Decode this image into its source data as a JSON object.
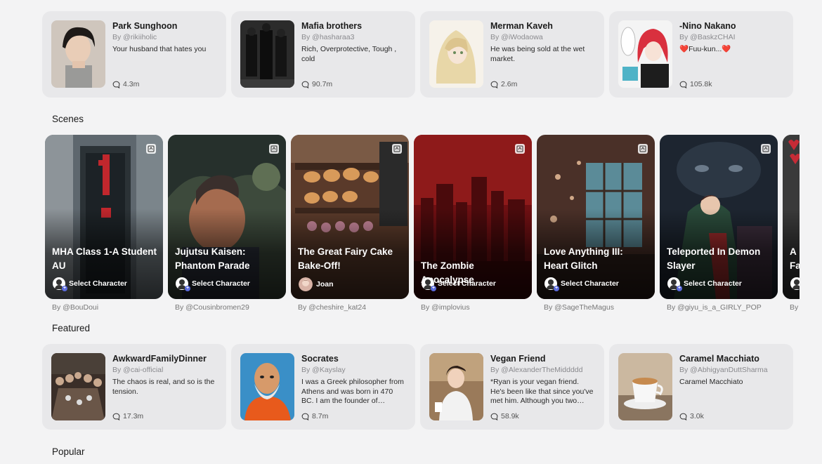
{
  "top_characters": [
    {
      "name": "Park Sunghoon",
      "by": "By @rikiiholic",
      "desc": "Your husband that hates you",
      "count": "4.3m",
      "avatar_icon": "portrait-dark-hair-icon"
    },
    {
      "name": "Mafia brothers",
      "by": "By @hasharaa3",
      "desc": "Rich, Overprotective, Tough , cold",
      "count": "90.7m",
      "avatar_icon": "men-in-suits-icon"
    },
    {
      "name": "Merman Kaveh",
      "by": "By @iWodaowa",
      "desc": "He was being sold at the wet market.",
      "count": "2.6m",
      "avatar_icon": "blond-anime-icon"
    },
    {
      "name": "-Nino Nakano",
      "by": "By @BaskzCHAI",
      "desc": "❤️Fuu-kun...❤️",
      "count": "105.8k",
      "avatar_icon": "red-hair-anime-icon"
    }
  ],
  "sections": {
    "scenes": "Scenes",
    "featured": "Featured",
    "popular": "Popular"
  },
  "scenes": [
    {
      "title": "MHA Class 1-A Student AU",
      "action": "Select Character",
      "by": "By @BouDoui"
    },
    {
      "title": "Jujutsu Kaisen: Phantom Parade",
      "action": "Select Character",
      "by": "By @Cousinbromen29"
    },
    {
      "title": "The Great Fairy Cake Bake-Off!",
      "action": "Joan",
      "by": "By @cheshire_kat24"
    },
    {
      "title": "The Zombie Apocalypse",
      "action": "Select Character",
      "by": "By @implovius"
    },
    {
      "title": "Love Anything III: Heart Glitch",
      "action": "Select Character",
      "by": "By @SageTheMagus"
    },
    {
      "title": "Teleported In Demon Slayer",
      "action": "Select Character",
      "by": "By @giyu_is_a_GIRLY_POP"
    },
    {
      "title": "A Fa",
      "action": "",
      "by": "By"
    }
  ],
  "featured_characters": [
    {
      "name": "AwkwardFamilyDinner",
      "by": "By @cai-official",
      "desc": "The chaos is real, and so is the tension.",
      "count": "17.3m",
      "avatar_icon": "dinner-table-icon"
    },
    {
      "name": "Socrates",
      "by": "By @Kayslay",
      "desc": "I was a Greek philosopher from Athens and was born in 470 BC. I am the founder of western...",
      "count": "8.7m",
      "avatar_icon": "bearded-philosopher-icon"
    },
    {
      "name": "Vegan Friend",
      "by": "By @AlexanderTheMiddddd",
      "desc": "*Ryan is your vegan friend. He's been like that since you've met him. Although you two disagre...",
      "count": "58.9k",
      "avatar_icon": "young-man-coffee-icon"
    },
    {
      "name": "Caramel Macchiato",
      "by": "By @AbhigyanDuttSharma",
      "desc": "Caramel Macchiato",
      "count": "3.0k",
      "avatar_icon": "coffee-cup-icon"
    }
  ],
  "colors": {
    "card_bg": "#e8e8ea",
    "page_bg": "#f3f3f4",
    "accent": "#5b6bdc"
  }
}
